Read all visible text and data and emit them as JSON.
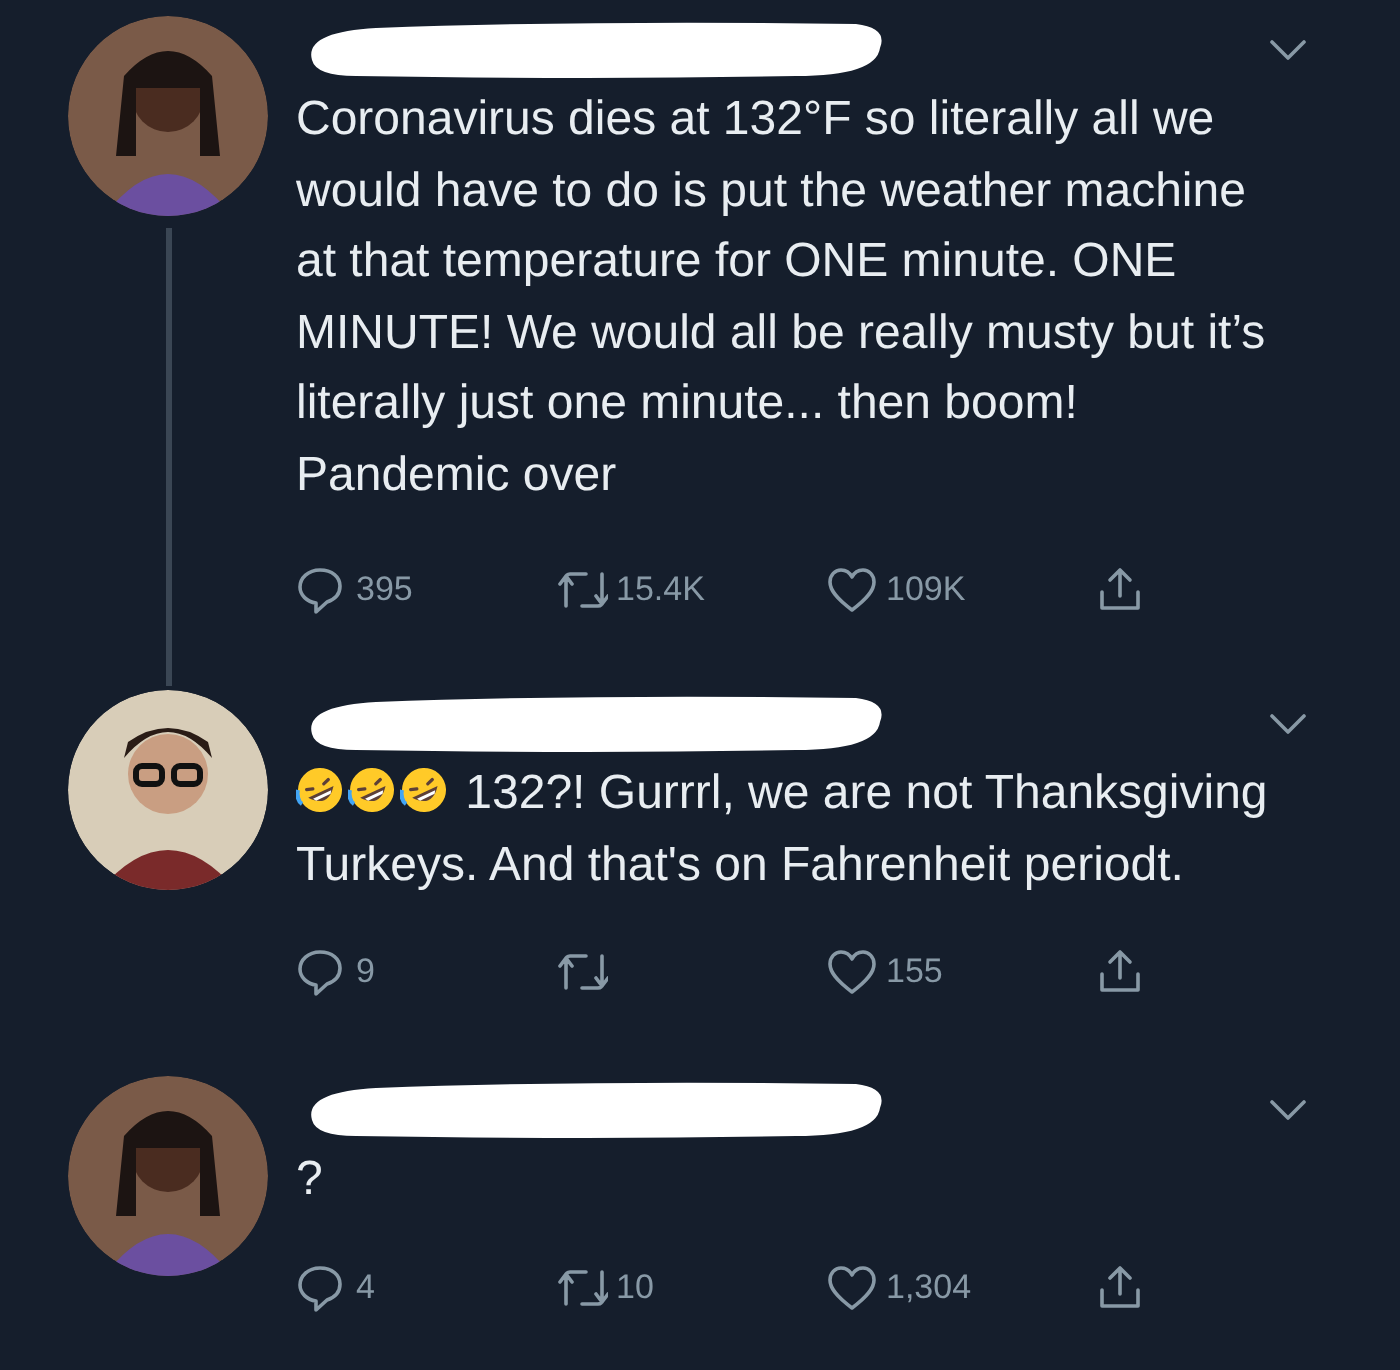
{
  "tweets": [
    {
      "kind": "post",
      "thread_line": true,
      "text": "Coronavirus dies at 132°F so literally all we would have to do is put the weather machine at that temperature for ONE minute. ONE MINUTE! We would all be really musty but it’s literally just one minute... then boom! Pandemic over",
      "replies": "395",
      "retweets": "15.4K",
      "likes": "109K"
    },
    {
      "kind": "laughing-reply",
      "thread_line": false,
      "text": "132?! Gurrrl, we are not Thanksgiving Turkeys. And that's on Fahrenheit periodt.",
      "replies": "9",
      "likes": "155"
    },
    {
      "kind": "post",
      "thread_line": false,
      "text": "?",
      "replies": "4",
      "retweets": "10",
      "likes": "1,304"
    }
  ]
}
